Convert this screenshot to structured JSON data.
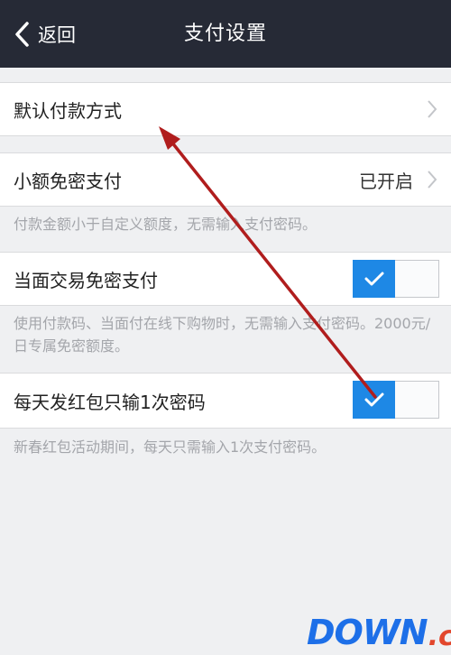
{
  "header": {
    "back_label": "返回",
    "title": "支付设置"
  },
  "default_payment": {
    "label": "默认付款方式"
  },
  "small_free": {
    "label": "小额免密支付",
    "status": "已开启",
    "note": "付款金额小于自定义额度，无需输入支付密码。"
  },
  "face_to_face": {
    "label": "当面交易免密支付",
    "enabled": true,
    "note": "使用付款码、当面付在线下购物时，无需输入支付密码。2000元/日专属免密额度。"
  },
  "red_packet": {
    "label": "每天发红包只输1次密码",
    "enabled": true,
    "note": "新春红包活动期间，每天只需输入1次支付密码。"
  },
  "watermark": {
    "part1": "DOWN",
    "part2": ".cc"
  },
  "colors": {
    "header_bg": "#262a36",
    "toggle_on": "#1e88e5",
    "annotation_arrow": "#b01d1d"
  }
}
